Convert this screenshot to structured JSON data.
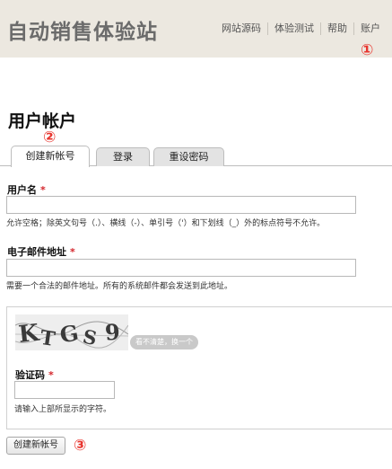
{
  "site": {
    "name": "自动销售体验站"
  },
  "topnav": {
    "items": [
      "网站源码",
      "体验测试",
      "帮助",
      "账户"
    ]
  },
  "markers": [
    "①",
    "②",
    "③"
  ],
  "page": {
    "title": "用户帐户"
  },
  "tabs": [
    {
      "label": "创建新帐号",
      "active": true
    },
    {
      "label": "登录",
      "active": false
    },
    {
      "label": "重设密码",
      "active": false
    }
  ],
  "form": {
    "username": {
      "label": "用户名",
      "required": "*",
      "value": "",
      "help": "允许空格；除英文句号（.）、横线（-）、单引号（'）和下划线（_）外的标点符号不允许。"
    },
    "email": {
      "label": "电子邮件地址",
      "required": "*",
      "value": "",
      "help": "需要一个合法的邮件地址。所有的系统邮件都会发送到此地址。"
    },
    "captcha": {
      "image_text": "KTGS9",
      "refresh_label": "看不清楚，换一个",
      "label": "验证码",
      "required": "*",
      "value": "",
      "help": "请输入上部所显示的字符。"
    },
    "submit_label": "创建新帐号"
  }
}
